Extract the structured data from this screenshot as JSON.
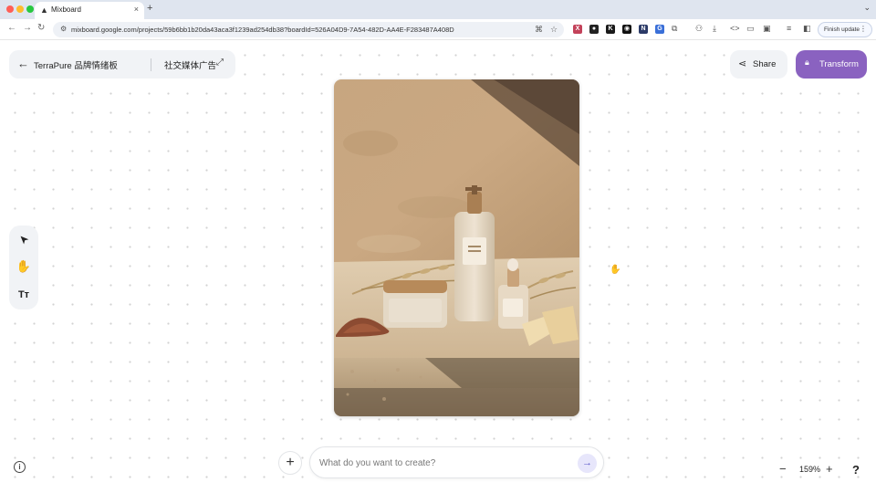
{
  "browser": {
    "tab_title": "Mixboard",
    "tab_close": "×",
    "new_tab": "+",
    "tab_dropdown": "⌄",
    "url": "mixboard.google.com/projects/59b6bb1b20da43aca3f1239ad254db38?boardId=526A04D9-7A54-482D-AA4E-F283487A408D",
    "finish_update_label": "Finish update",
    "menu_glyph": "⋮"
  },
  "header": {
    "back_glyph": "←",
    "board_title": "TerraPure 品牌情绪板",
    "sub_title": "社交媒体广告",
    "expand_glyph": "⤢",
    "share_label": "Share",
    "transform_label": "Transform"
  },
  "tools": {
    "select_glyph": "➤",
    "hand_glyph": "✋",
    "text_glyph": "Tт"
  },
  "prompt": {
    "placeholder": "What do you want to create?",
    "add_glyph": "+",
    "send_glyph": "→"
  },
  "zoom": {
    "out_glyph": "−",
    "level": "159%",
    "in_glyph": "+"
  },
  "help_glyph": "?",
  "info_glyph": "i",
  "colors": {
    "transform_bg": "#8a62c0",
    "send_bg": "#e7e6fb",
    "image_wall": "#c9a985",
    "image_stone": "#d9c3a4"
  }
}
